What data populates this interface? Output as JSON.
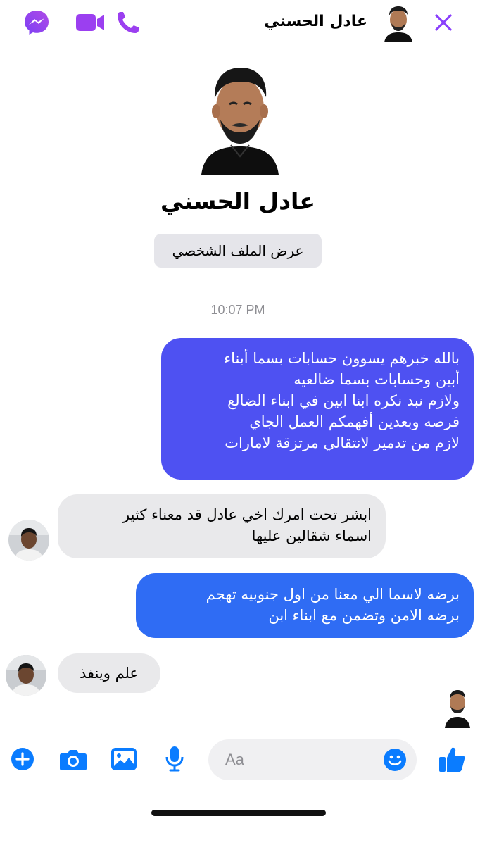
{
  "header": {
    "contact_name": "عادل الحسني",
    "icons": [
      "messenger-icon",
      "video-call-icon",
      "phone-call-icon",
      "close-icon"
    ]
  },
  "profile": {
    "name": "عادل الحسني",
    "view_profile_label": "عرض الملف الشخصي"
  },
  "conversation": {
    "timestamp": "10:07 PM",
    "messages": [
      {
        "direction": "outgoing",
        "lines": [
          "بالله خبرهم يسوون حسابات بسما أبناء",
          "أبين وحسابات بسما ضالعيه",
          "ولازم نبد نكره ابنا ابين في ابناء الضالع",
          "فرصه وبعدين أفهمكم العمل الجاي",
          "لازم من تدمير لانتقالي مرتزقة لامارات"
        ]
      },
      {
        "direction": "incoming",
        "lines": [
          "ابشر تحت امرك اخي عادل قد معناء كثير",
          "اسماء شقالين عليها"
        ]
      },
      {
        "direction": "outgoing",
        "lines": [
          "برضه لاسما الي معنا من اول جنوبيه تهجم",
          "برضه الامن  وتضمن مع ابناء ابن"
        ]
      },
      {
        "direction": "incoming",
        "lines": [
          "علم وينفذ"
        ]
      }
    ]
  },
  "composer": {
    "placeholder": "Aa",
    "icons": [
      "plus-icon",
      "camera-icon",
      "gallery-icon",
      "microphone-icon",
      "emoji-icon",
      "like-icon"
    ]
  },
  "colors": {
    "accent": "#8a3ffc",
    "messenger_blue": "#0a7cff",
    "outgoing_bubble_1": "#4e51f2",
    "outgoing_bubble_2": "#2f6cf4",
    "incoming_bubble": "#e9e9eb"
  }
}
